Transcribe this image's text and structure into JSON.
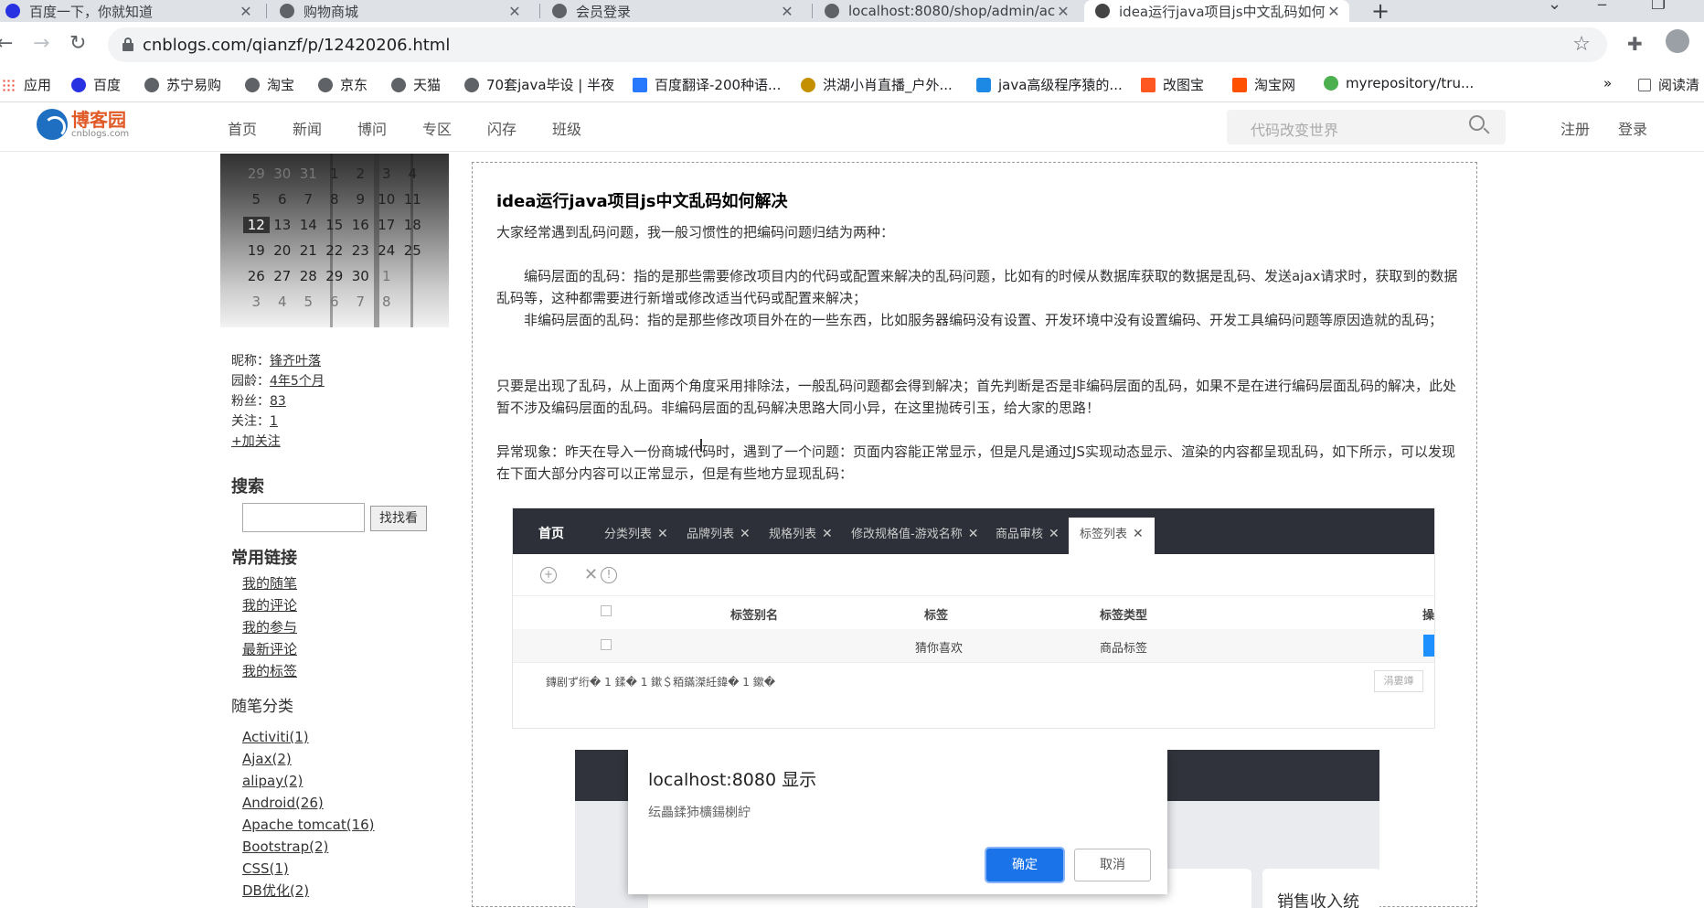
{
  "browser": {
    "tabs": [
      {
        "title": "百度一下，你就知道"
      },
      {
        "title": "购物商城"
      },
      {
        "title": "会员登录"
      },
      {
        "title": "localhost:8080/shop/admin/ac"
      },
      {
        "title": "idea运行java项目js中文乱码如何"
      }
    ],
    "url": "cnblogs.com/qianzf/p/12420206.html",
    "bookmarks": [
      {
        "label": "应用",
        "color": "#ea4335"
      },
      {
        "label": "百度",
        "color": "#2932e1"
      },
      {
        "label": "苏宁易购",
        "color": "#5f6368"
      },
      {
        "label": "淘宝",
        "color": "#5f6368"
      },
      {
        "label": "京东",
        "color": "#5f6368"
      },
      {
        "label": "天猫",
        "color": "#5f6368"
      },
      {
        "label": "70套java毕设 | 半夜",
        "color": "#5f6368"
      },
      {
        "label": "百度翻译-200种语...",
        "color": "#2979ff"
      },
      {
        "label": "洪湖小肖直播_户外...",
        "color": "#c59000"
      },
      {
        "label": "java高级程序猿的...",
        "color": "#1e88e5"
      },
      {
        "label": "改图宝",
        "color": "#ff5722"
      },
      {
        "label": "淘宝网",
        "color": "#ff5000"
      },
      {
        "label": "myrepository/tru...",
        "color": "#4caf50"
      }
    ],
    "overflow_label": "»",
    "reading_list": "阅读清"
  },
  "site": {
    "logo_cn": "博客园",
    "logo_en": "cnblogs.com",
    "menu": [
      "首页",
      "新闻",
      "博问",
      "专区",
      "闪存",
      "班级"
    ],
    "search_placeholder": "代码改变世界",
    "register": "注册",
    "login": "登录"
  },
  "sidebar": {
    "calendar": [
      [
        "29",
        "30",
        "31",
        "1",
        "2",
        "3",
        "4"
      ],
      [
        "5",
        "6",
        "7",
        "8",
        "9",
        "10",
        "11"
      ],
      [
        "12",
        "13",
        "14",
        "15",
        "16",
        "17",
        "18"
      ],
      [
        "19",
        "20",
        "21",
        "22",
        "23",
        "24",
        "25"
      ],
      [
        "26",
        "27",
        "28",
        "29",
        "30",
        "1",
        ""
      ],
      [
        "3",
        "4",
        "5",
        "6",
        "7",
        "8",
        ""
      ]
    ],
    "profile": {
      "nickname_label": "昵称：",
      "nickname": "锋齐叶落",
      "age_label": "园龄：",
      "age": "4年5个月",
      "fans_label": "粉丝：",
      "fans": "83",
      "follow_label": "关注：",
      "follow": "1",
      "add_follow": "+加关注"
    },
    "search_heading": "搜索",
    "search_button": "找找看",
    "links_heading": "常用链接",
    "links": [
      "我的随笔",
      "我的评论",
      "我的参与",
      "最新评论",
      "我的标签"
    ],
    "categories_heading": "随笔分类",
    "categories": [
      "Activiti(1)",
      "Ajax(2)",
      "alipay(2)",
      "Android(26)",
      "Apache tomcat(16)",
      "Bootstrap(2)",
      "CSS(1)",
      "DB优化(2)"
    ]
  },
  "article": {
    "title": "idea运行java项目js中文乱码如何解决",
    "p1": "大家经常遇到乱码问题，我一般习惯性的把编码问题归结为两种：",
    "p2": "编码层面的乱码：指的是那些需要修改项目内的代码或配置来解决的乱码问题，比如有的时候从数据库获取的数据是乱码、发送ajax请求时，获取到的数据乱码等，这种都需要进行新增或修改适当代码或配置来解决；",
    "p3": "非编码层面的乱码：指的是那些修改项目外在的一些东西，比如服务器编码没有设置、开发环境中没有设置编码、开发工具编码问题等原因造就的乱码；",
    "p4": "只要是出现了乱码，从上面两个角度采用排除法，一般乱码问题都会得到解决；首先判断是否是非编码层面的乱码，如果不是在进行编码层面乱码的解决，此处暂不涉及编码层面的乱码。非编码层面的乱码解决思路大同小异，在这里抛砖引玉，给大家的思路！",
    "p5": "异常现象：昨天在导入一份商城代码时，遇到了一个问题：页面内容能正常显示，但是凡是通过JS实现动态显示、渲染的内容都呈现乱码，如下所示，可以发现在下面大部分内容可以正常显示，但是有些地方显现乱码："
  },
  "screenshot1": {
    "home": "首页",
    "tabs": [
      "分类列表",
      "品牌列表",
      "规格列表",
      "修改规格值-游戏名称",
      "商品审核",
      "标签列表"
    ],
    "headers": [
      "标签别名",
      "标签",
      "标签类型",
      "操"
    ],
    "row": {
      "alias": "",
      "tag": "猜你喜欢",
      "type": "商品标签"
    },
    "footer_text": "鏄剧ず绗� 1 鍒� 1 鏉＄粨鏋滐紝鍏� 1 鏉�",
    "page_button": "涓婁竴"
  },
  "screenshot2": {
    "dialog_title": "localhost:8080 显示",
    "dialog_message": "纭畾鍒犻櫎鍚楋紵",
    "ok": "确定",
    "cancel": "取消",
    "card_text": "销售收入统"
  }
}
